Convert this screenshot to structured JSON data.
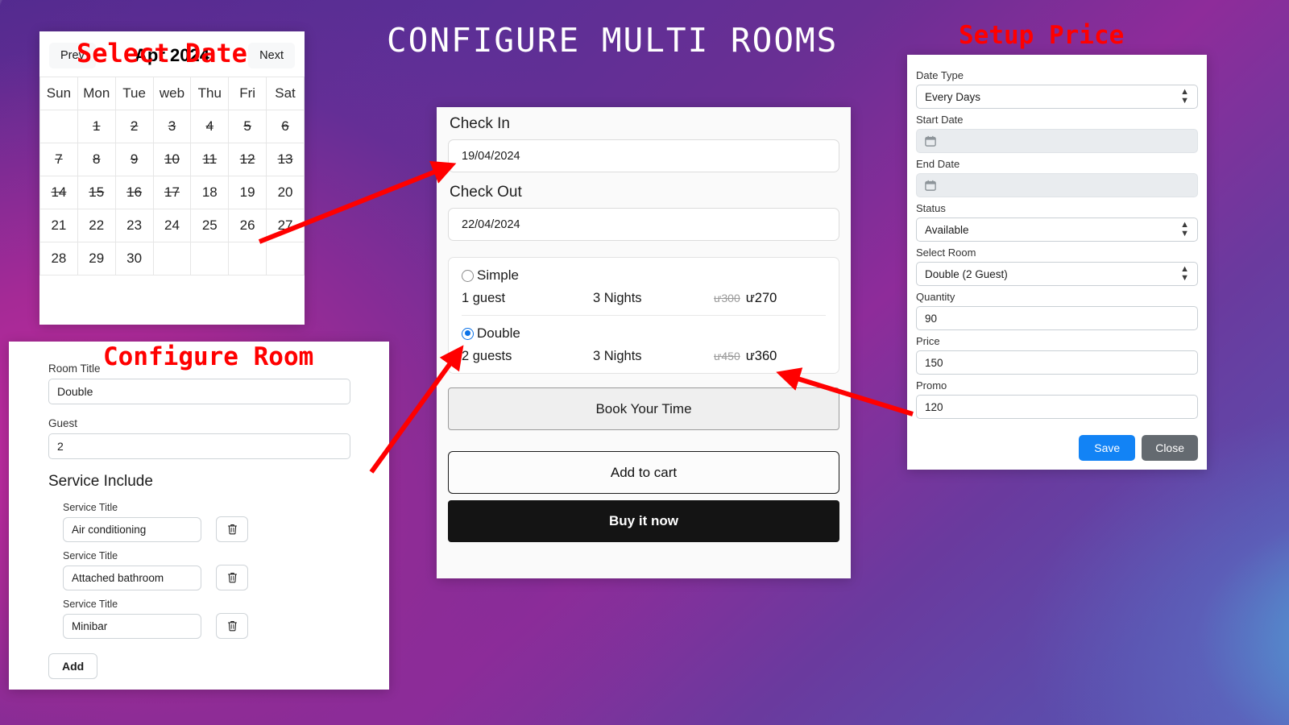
{
  "page": {
    "main_title": "CONFIGURE MULTI ROOMS"
  },
  "annotations": [
    {
      "text": "Select Date",
      "name": "annotation-select-date"
    },
    {
      "text": "Configure Room",
      "name": "annotation-configure-room"
    },
    {
      "text": "Setup Price",
      "name": "annotation-setup-price"
    }
  ],
  "calendar": {
    "prev_label": "Prev",
    "next_label": "Next",
    "month_label": "Apr 2024",
    "weekdays": [
      "Sun",
      "Mon",
      "Tue",
      "web",
      "Thu",
      "Fri",
      "Sat"
    ],
    "selected_day": "19",
    "weeks": [
      [
        {
          "d": "",
          "s": "empty"
        },
        {
          "d": "1",
          "s": "dis"
        },
        {
          "d": "2",
          "s": "dis"
        },
        {
          "d": "3",
          "s": "dis"
        },
        {
          "d": "4",
          "s": "dis"
        },
        {
          "d": "5",
          "s": "dis"
        },
        {
          "d": "6",
          "s": "dis"
        }
      ],
      [
        {
          "d": "7",
          "s": "dis"
        },
        {
          "d": "8",
          "s": "dis"
        },
        {
          "d": "9",
          "s": "dis"
        },
        {
          "d": "10",
          "s": "dis"
        },
        {
          "d": "11",
          "s": "dis"
        },
        {
          "d": "12",
          "s": "dis"
        },
        {
          "d": "13",
          "s": "dis"
        }
      ],
      [
        {
          "d": "14",
          "s": "dis"
        },
        {
          "d": "15",
          "s": "dis"
        },
        {
          "d": "16",
          "s": "dis"
        },
        {
          "d": "17",
          "s": "dis"
        },
        {
          "d": "18",
          "s": "on"
        },
        {
          "d": "19",
          "s": "sel"
        },
        {
          "d": "20",
          "s": "on"
        }
      ],
      [
        {
          "d": "21",
          "s": "on"
        },
        {
          "d": "22",
          "s": "on"
        },
        {
          "d": "23",
          "s": "on"
        },
        {
          "d": "24",
          "s": "on"
        },
        {
          "d": "25",
          "s": "on"
        },
        {
          "d": "26",
          "s": "on"
        },
        {
          "d": "27",
          "s": "on"
        }
      ],
      [
        {
          "d": "28",
          "s": "on"
        },
        {
          "d": "29",
          "s": "on"
        },
        {
          "d": "30",
          "s": "on"
        },
        {
          "d": "",
          "s": "empty"
        },
        {
          "d": "",
          "s": "empty"
        },
        {
          "d": "",
          "s": "empty"
        },
        {
          "d": "",
          "s": "empty"
        }
      ]
    ]
  },
  "room_form": {
    "room_title_label": "Room Title",
    "room_title_value": "Double",
    "guest_label": "Guest",
    "guest_value": "2",
    "service_section_label": "Service Include",
    "service_title_label": "Service Title",
    "services": [
      {
        "value": "Air conditioning"
      },
      {
        "value": "Attached bathroom"
      },
      {
        "value": "Minibar"
      }
    ],
    "add_label": "Add",
    "delete_icon": "trash-icon"
  },
  "booking": {
    "check_in_label": "Check In",
    "check_in_value": "19/04/2024",
    "check_out_label": "Check Out",
    "check_out_value": "22/04/2024",
    "rates": [
      {
        "name": "Simple",
        "selected": false,
        "guests": "1 guest",
        "nights": "3 Nights",
        "old_price": "ư300",
        "new_price": "ư270"
      },
      {
        "name": "Double",
        "selected": true,
        "guests": "2 guests",
        "nights": "3 Nights",
        "old_price": "ư450",
        "new_price": "ư360"
      }
    ],
    "book_label": "Book Your Time",
    "add_to_cart_label": "Add to cart",
    "buy_now_label": "Buy it now"
  },
  "price_setup": {
    "date_type_label": "Date Type",
    "date_type_value": "Every Days",
    "start_date_label": "Start Date",
    "start_date_value": "",
    "end_date_label": "End Date",
    "end_date_value": "",
    "status_label": "Status",
    "status_value": "Available",
    "select_room_label": "Select Room",
    "select_room_value": "Double (2 Guest)",
    "quantity_label": "Quantity",
    "quantity_value": "90",
    "price_label": "Price",
    "price_value": "150",
    "promo_label": "Promo",
    "promo_value": "120",
    "save_label": "Save",
    "close_label": "Close",
    "calendar_icon": "calendar-icon"
  },
  "colors": {
    "annotation_red": "#ff0000",
    "selected_day_green": "#0a8f2a",
    "radio_blue": "#0b72e8",
    "save_blue": "#1283f5",
    "close_grey": "#646a70",
    "buy_now_black": "#141414"
  }
}
